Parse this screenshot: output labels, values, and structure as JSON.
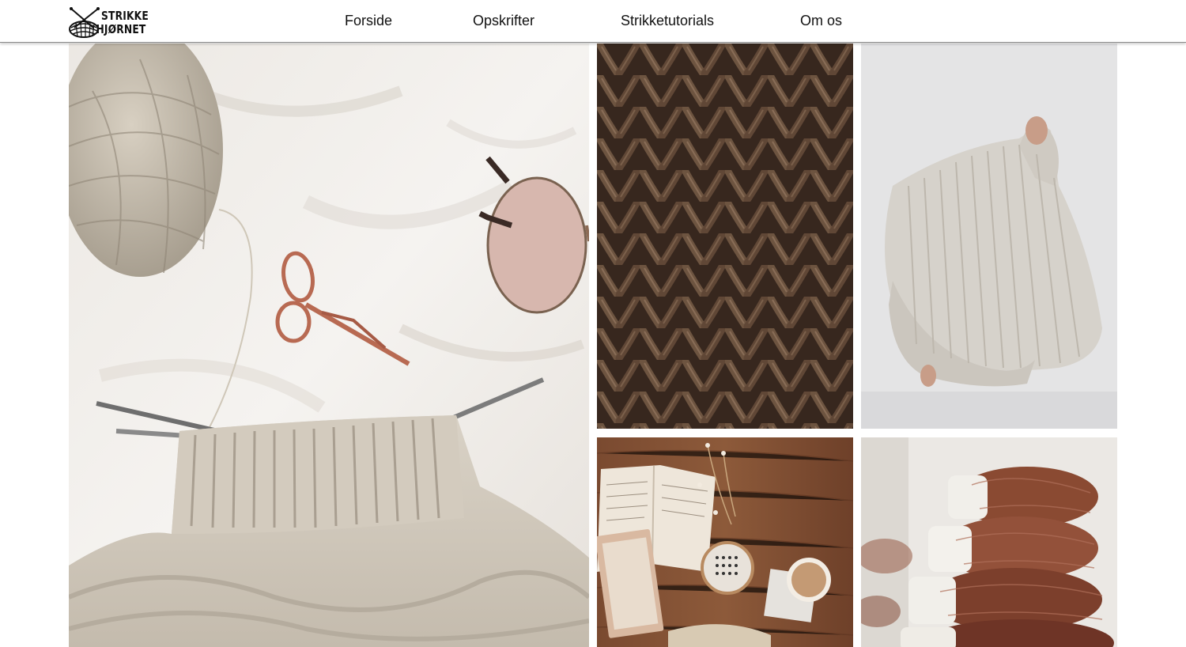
{
  "brand": {
    "line1": "STRIKKE",
    "line2": "HJØRNET",
    "icon": "knitting-basket-icon"
  },
  "nav": {
    "items": [
      {
        "label": "Forside"
      },
      {
        "label": "Opskrifter"
      },
      {
        "label": "Strikketutorials"
      },
      {
        "label": "Om os"
      }
    ]
  },
  "gallery": {
    "images": [
      {
        "subject": "yarn-scissors-glasses-knitting"
      },
      {
        "subject": "brown-knit-texture"
      },
      {
        "subject": "person-pulling-white-sweater"
      },
      {
        "subject": "notebook-coffee-wooden-table"
      },
      {
        "subject": "mohair-yarn-skeins"
      }
    ]
  },
  "colors": {
    "header_bg": "#ffffff",
    "text": "#111111",
    "header_border": "#8a8a8a"
  }
}
